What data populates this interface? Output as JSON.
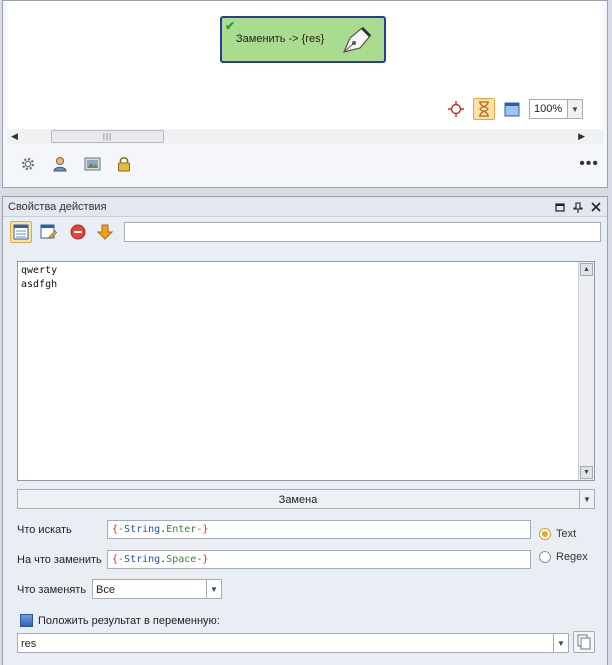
{
  "canvas": {
    "node": {
      "label": "Заменить -> {res}"
    },
    "toolbar": {
      "zoom_value": "100%"
    },
    "scrollbar": {
      "thumb_grip": "|||"
    },
    "status_bar": {
      "more_label": "•••"
    }
  },
  "properties": {
    "title": "Свойства действия",
    "input_text": {
      "lines": [
        "qwerty",
        "asdfgh"
      ]
    },
    "mode_label": "Замена",
    "find": {
      "label": "Что искать",
      "brace_open": "{-",
      "object": "String",
      "dot": ".",
      "property": "Enter",
      "brace_close": "-}"
    },
    "replace": {
      "label": "На что заменить",
      "brace_open": "{-",
      "object": "String",
      "dot": ".",
      "property": "Space",
      "brace_close": "-}"
    },
    "what_replace": {
      "label": "Что заменять",
      "value": "Все"
    },
    "radio": {
      "text_label": "Text",
      "regex_label": "Regex",
      "selected": "Text"
    },
    "result": {
      "label": "Положить результат в переменную:",
      "variable": "res"
    }
  },
  "colors": {
    "node_fill": "#a9dc8f",
    "node_border": "#2c3aa0",
    "token_brace": "#c0392b",
    "token_object": "#1f4fbf",
    "token_property": "#2e8b2e",
    "radio_selected": "#e7a91f"
  }
}
